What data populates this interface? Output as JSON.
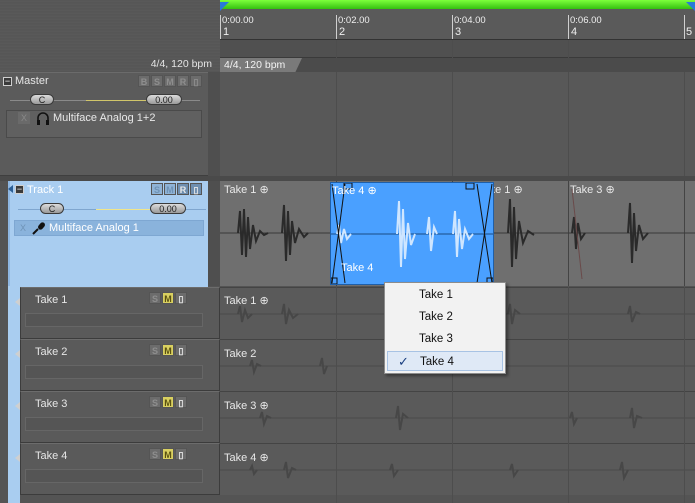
{
  "ruler": {
    "marks": [
      {
        "time": "0:00.00",
        "bar": "1"
      },
      {
        "time": "0:02.00",
        "bar": "2"
      },
      {
        "time": "0:04.00",
        "bar": "3"
      },
      {
        "time": "0:06.00",
        "bar": "4"
      },
      {
        "time": "",
        "bar": "5"
      }
    ],
    "signature": "4/4, 120 bpm",
    "signature_lane": "4/4, 120 bpm"
  },
  "master": {
    "name": "Master",
    "buttons": [
      "B",
      "S",
      "M",
      "R",
      "▯"
    ],
    "pan": "C",
    "volume": "0.00",
    "output": "Multiface Analog 1+2",
    "x_label": "X"
  },
  "track1": {
    "name": "Track 1",
    "buttons": [
      "S",
      "M",
      "R",
      "▯"
    ],
    "pan": "C",
    "volume": "0.00",
    "input": "Multiface Analog 1",
    "x_label": "X",
    "clips": [
      {
        "label": "Take 1 ⊕"
      },
      {
        "label": "Take 4 ⊕"
      },
      {
        "label": "Take 1 ⊕"
      },
      {
        "label": "Take 3 ⊕"
      }
    ],
    "selected_clip_footer": "Take 4"
  },
  "takes": [
    {
      "name": "Take 1",
      "lane_label": "Take 1 ⊕",
      "buttons": [
        "S",
        "M",
        "▯"
      ]
    },
    {
      "name": "Take 2",
      "lane_label": "Take 2",
      "buttons": [
        "S",
        "M",
        "▯"
      ]
    },
    {
      "name": "Take 3",
      "lane_label": "Take 3 ⊕",
      "buttons": [
        "S",
        "M",
        "▯"
      ]
    },
    {
      "name": "Take 4",
      "lane_label": "Take 4 ⊕",
      "buttons": [
        "S",
        "M",
        "▯"
      ]
    }
  ],
  "take_menu": {
    "items": [
      "Take 1",
      "Take 2",
      "Take 3",
      "Take 4"
    ],
    "checked_index": 3,
    "check_glyph": "✓"
  },
  "colors": {
    "selection": "#4aa0ff",
    "track_selected": "#a9cdf0",
    "loop": "#4ed020",
    "mute_active": "#d9d060"
  }
}
